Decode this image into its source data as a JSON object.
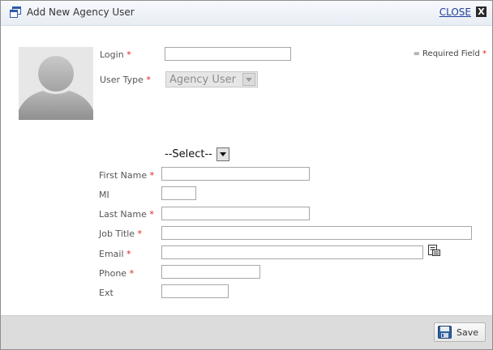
{
  "dialog": {
    "title": "Add New Agency User",
    "close_label": "CLOSE",
    "close_x": "X"
  },
  "required_note": "= Required Field",
  "required_mark": "*",
  "form": {
    "login": {
      "label": "Login",
      "value": ""
    },
    "user_type": {
      "label": "User Type",
      "value": "Agency User"
    },
    "agency_select": {
      "value": "--Select--"
    },
    "first_name": {
      "label": "First Name",
      "value": ""
    },
    "mi": {
      "label": "MI",
      "value": ""
    },
    "last_name": {
      "label": "Last Name",
      "value": ""
    },
    "job_title": {
      "label": "Job Title",
      "value": ""
    },
    "email": {
      "label": "Email",
      "value": ""
    },
    "phone": {
      "label": "Phone",
      "value": ""
    },
    "ext": {
      "label": "Ext",
      "value": ""
    }
  },
  "footer": {
    "save_label": "Save"
  },
  "colors": {
    "required": "#e02020",
    "link": "#1f3d99",
    "footer_bg": "#dcdcdc"
  },
  "icons": [
    "add-window-icon",
    "close-icon",
    "avatar-placeholder",
    "address-book-icon",
    "save-icon"
  ]
}
